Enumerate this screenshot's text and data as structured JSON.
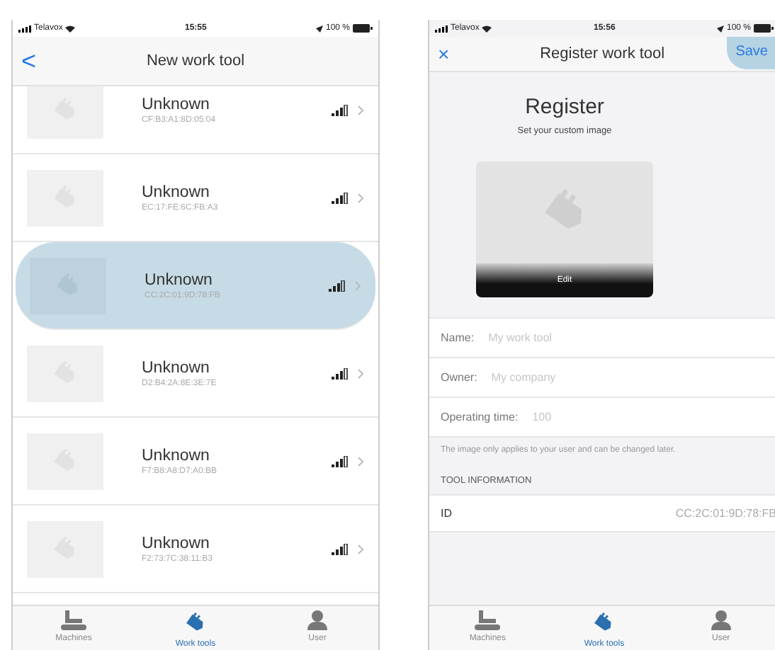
{
  "left_screen": {
    "status_bar": {
      "carrier": "Telavox",
      "time": "15:55",
      "battery": "100 %"
    },
    "nav": {
      "back": "<",
      "title": "New work tool"
    },
    "devices": [
      {
        "name": "Unknown",
        "address": "CF:B3:A1:8D:05:04",
        "highlighted": false
      },
      {
        "name": "Unknown",
        "address": "EC:17:FE:6C:FB:A3",
        "highlighted": false
      },
      {
        "name": "Unknown",
        "address": "CC:2C:01:9D:78:FB",
        "highlighted": true
      },
      {
        "name": "Unknown",
        "address": "D2:B4:2A:8E:3E:7E",
        "highlighted": false
      },
      {
        "name": "Unknown",
        "address": "F7:B8:A8:D7:A0:BB",
        "highlighted": false
      },
      {
        "name": "Unknown",
        "address": "F2:73:7C:38:11:B3",
        "highlighted": false
      }
    ],
    "tabs": [
      {
        "label": "Machines",
        "selected": false
      },
      {
        "label": "Work tools",
        "selected": true
      },
      {
        "label": "User",
        "selected": false
      }
    ]
  },
  "right_screen": {
    "status_bar": {
      "carrier": "Telavox",
      "time": "15:56",
      "battery": "100 %"
    },
    "nav": {
      "close": "×",
      "title": "Register work tool",
      "save": "Save",
      "save_highlighted": true
    },
    "heading": "Register",
    "subheading": "Set your custom image",
    "image_button": "Edit",
    "fields": [
      {
        "label": "Name:",
        "placeholder": "My work tool"
      },
      {
        "label": "Owner:",
        "placeholder": "My company"
      },
      {
        "label": "Operating time:",
        "placeholder": "100"
      }
    ],
    "note": "The image only applies to your user and can be changed later.",
    "section_title": "TOOL INFORMATION",
    "info": [
      {
        "label": "ID",
        "value": "CC:2C:01:9D:78:FB"
      }
    ],
    "tabs": [
      {
        "label": "Machines",
        "selected": false
      },
      {
        "label": "Work tools",
        "selected": true
      },
      {
        "label": "User",
        "selected": false
      }
    ]
  }
}
